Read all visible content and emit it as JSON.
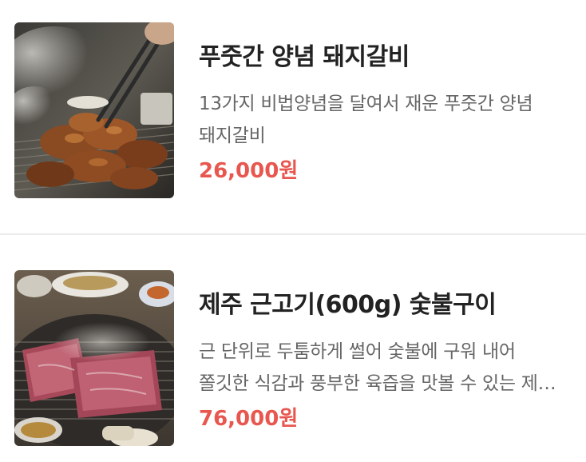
{
  "menu": {
    "items": [
      {
        "name": "푸줏간 양념 돼지갈비",
        "description": "13가지 비법양념을 달여서 재운 푸줏간 양념 돼지갈비",
        "price": "26,000원",
        "image": "grilled-marinated-pork-ribs-photo"
      },
      {
        "name": "제주 근고기(600g) 숯불구이",
        "description": "근 단위로 두툼하게 썰어 숯불에 구워 내어 쫄깃한 식감과 풍부한 육즙을 맛볼 수 있는 제주 근고기",
        "price": "76,000원",
        "image": "jeju-thick-pork-on-grill-photo"
      }
    ]
  },
  "colors": {
    "price": "#e8574f",
    "title": "#222222",
    "description": "#666666",
    "divider": "#ececec"
  }
}
